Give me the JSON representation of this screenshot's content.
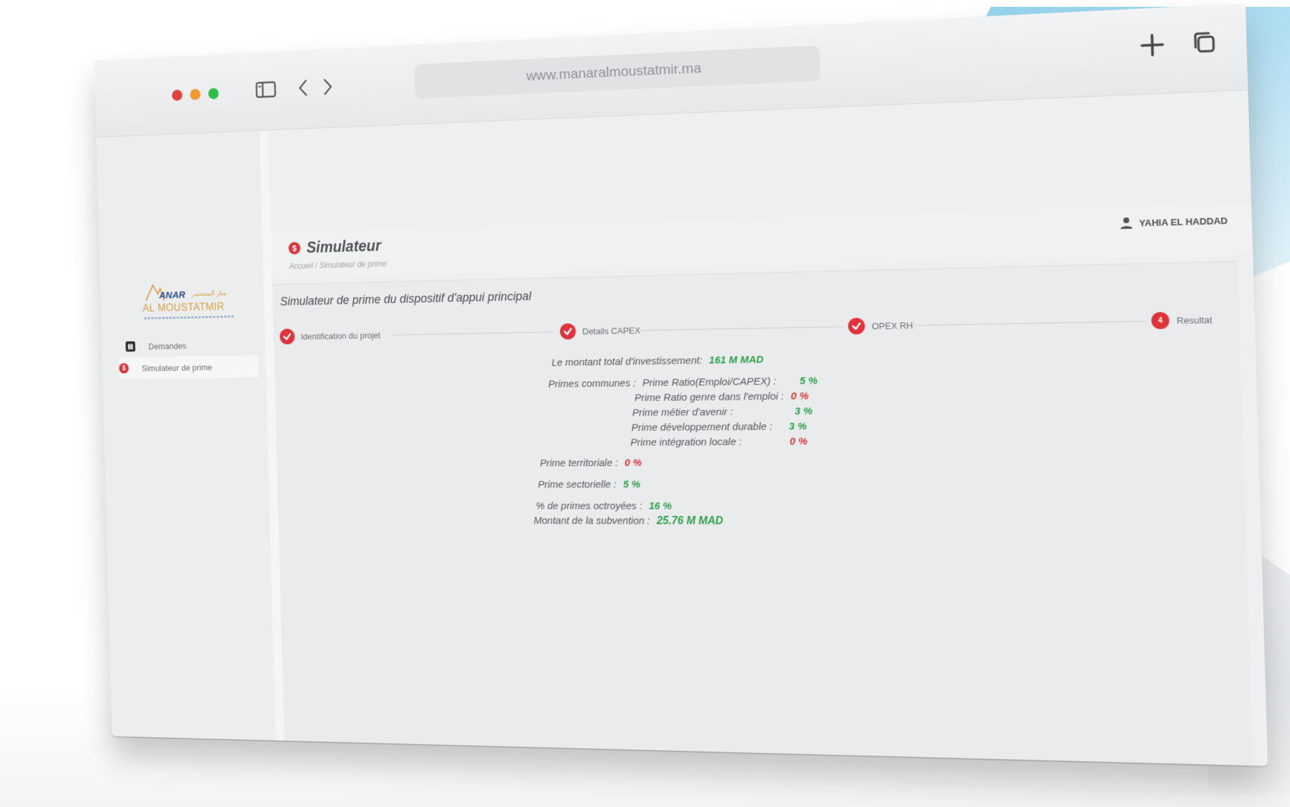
{
  "browser": {
    "url": "www.manaralmoustatmir.ma"
  },
  "sidebar": {
    "logo": {
      "name": "ANAR",
      "arabic": "منار المستثمر",
      "subtitle": "AL MOUSTATMIR"
    },
    "items": [
      {
        "label": "Demandes",
        "icon": "document-icon"
      },
      {
        "label": "Simulateur de prime",
        "icon": "currency-icon"
      }
    ]
  },
  "header": {
    "title": "Simulateur",
    "breadcrumb": "Accueil / Simulateur de prime",
    "user": "YAHIA EL HADDAD"
  },
  "card": {
    "title": "Simulateur de prime du dispositif d'appui principal",
    "steps": [
      {
        "label": "Identification du projet",
        "state": "done"
      },
      {
        "label": "Details CAPEX",
        "state": "done"
      },
      {
        "label": "OPEX RH",
        "state": "done"
      },
      {
        "label": "Resultat",
        "state": "current",
        "number": "4"
      }
    ],
    "results": {
      "total_label": "Le montant total d'investissement:",
      "total_value": "161 M MAD",
      "communes_label": "Primes communes :",
      "communes": [
        {
          "label": "Prime Ratio(Emploi/CAPEX) :",
          "value": "5 %",
          "color": "green"
        },
        {
          "label": "Prime Ratio genre dans l'emploi :",
          "value": "0 %",
          "color": "red"
        },
        {
          "label": "Prime métier d'avenir :",
          "value": "3 %",
          "color": "green"
        },
        {
          "label": "Prime développement durable :",
          "value": "3 %",
          "color": "green"
        },
        {
          "label": "Prime intégration locale :",
          "value": "0 %",
          "color": "red"
        }
      ],
      "territoriale_label": "Prime territoriale :",
      "territoriale_value": "0 %",
      "sectorielle_label": "Prime sectorielle :",
      "sectorielle_value": "5 %",
      "octroyees_label": "% de primes octroyées :",
      "octroyees_value": "16 %",
      "subvention_label": "Montant de la subvention :",
      "subvention_value": "25.76 M MAD"
    }
  },
  "colors": {
    "accent_red": "#e0343c",
    "value_green": "#2ea04a",
    "value_red": "#d93a3a"
  }
}
